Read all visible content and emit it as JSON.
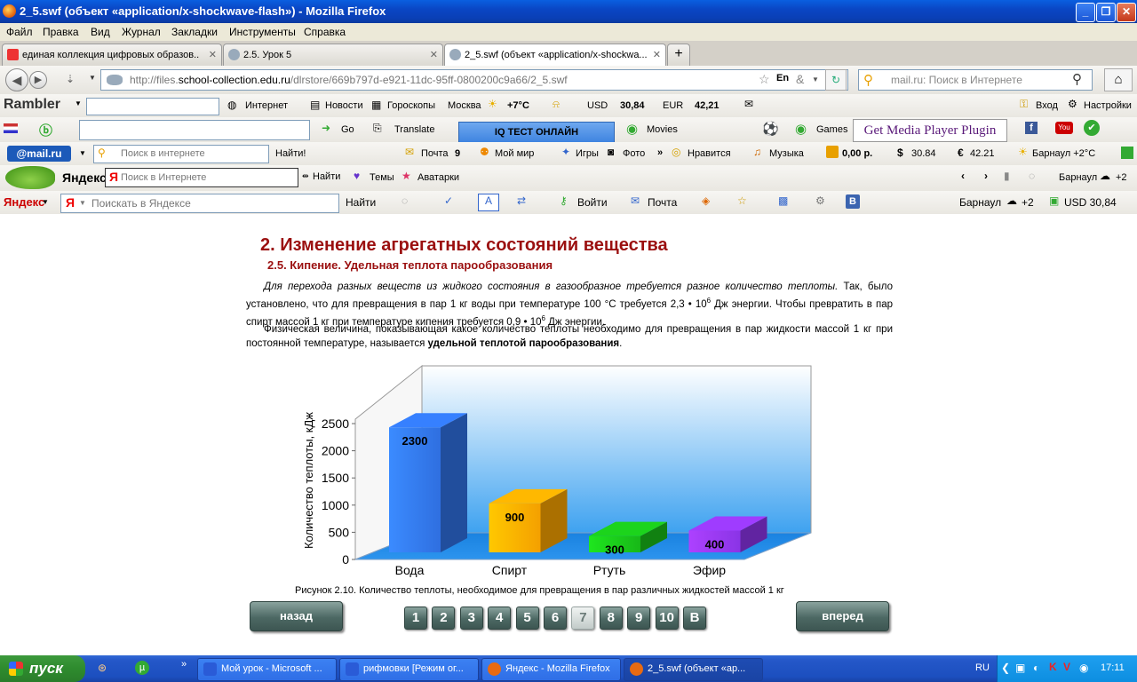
{
  "window": {
    "title": "2_5.swf (объект «application/x-shockwave-flash») - Mozilla Firefox",
    "min": "_",
    "max": "❐",
    "close": "✕"
  },
  "menu": [
    "Файл",
    "Правка",
    "Вид",
    "Журнал",
    "Закладки",
    "Инструменты",
    "Справка"
  ],
  "tabs": [
    {
      "label": "единая коллекция цифровых образов...",
      "close": "✕"
    },
    {
      "label": "2.5. Урок 5",
      "close": "✕"
    },
    {
      "label": "2_5.swf (объект «application/x-shockwa...",
      "close": "✕"
    }
  ],
  "new_tab": "+",
  "nav": {
    "url_prefix": "http://files.",
    "url_domain": "school-collection.edu.ru",
    "url_path": "/dlrstore/669b797d-e921-11dc-95ff-0800200c9a66/2_5.swf",
    "search_placeholder": "mail.ru: Поиск в Интернете",
    "lang": "En"
  },
  "rambler": {
    "logo": "Rambler",
    "internet": "Интернет",
    "news": "Новости",
    "horoscope": "Гороскопы",
    "city": "Москва",
    "temp": "+7°C",
    "usd_label": "USD",
    "usd": "30,84",
    "eur_label": "EUR",
    "eur": "42,21",
    "login": "Вход",
    "settings": "Настройки"
  },
  "toolbar2": {
    "go": "Go",
    "translate": "Translate",
    "iq": "IQ ТЕСТ ОНЛАЙН",
    "movies": "Movies",
    "games": "Games",
    "plugin": "Get Media Player Plugin"
  },
  "mailru": {
    "logo": "@mail.ru",
    "placeholder": "Поиск в интернете",
    "find": "Найти!",
    "mail": "Почта",
    "mail_count": "9",
    "myworld": "Мой мир",
    "games": "Игры",
    "photo": "Фото",
    "likes": "Нравится",
    "music": "Музыка",
    "money": "0,00 р.",
    "usd": "30.84",
    "eur": "42.21",
    "weather": "Барнаул +2°C"
  },
  "yandex_bar1": {
    "logo": "Яндекс",
    "placeholder": "Поиск в Интернете",
    "find": "Найти",
    "themes": "Темы",
    "avatars": "Аватарки",
    "city": "Барнаул",
    "temp": "+2"
  },
  "yandex_bar2": {
    "logo": "Яндекс",
    "placeholder": "Поискать в Яндексе",
    "find": "Найти",
    "login": "Войти",
    "mail": "Почта",
    "city": "Барнаул",
    "temp": "+2",
    "usd": "USD 30,84"
  },
  "page": {
    "title": "2. Изменение агрегатных состояний вещества",
    "subtitle": "2.5. Кипение. Удельная теплота парообразования",
    "p1_italic": "Для перехода разных веществ из жидкого состояния в газообразное требуется разное количество теплоты.",
    "p1_rest_a": " Так, было установлено, что для превращения в пар 1 кг воды при температуре 100 °С требуется 2,3 • 10",
    "p1_exp": "6",
    "p1_rest_b": " Дж энергии. Чтобы превратить в пар спирт массой 1 кг при температуре кипения требуется 0,9 • 10",
    "p1_exp2": "6",
    "p1_rest_c": " Дж энергии.",
    "p2_a": "Физическая величина, показывающая какое количество теплоты необходимо для превращения в пар жидкости массой 1 кг при постоянной температуре, называется ",
    "p2_bold": "удельной теплотой парообразования",
    "p2_end": ".",
    "caption": "Рисунок 2.10. Количество теплоты, необходимое для превращения в пар различных жидкостей массой 1 кг",
    "back": "назад",
    "forward": "вперед",
    "pages": [
      "1",
      "2",
      "3",
      "4",
      "5",
      "6",
      "7",
      "8",
      "9",
      "10",
      "В"
    ],
    "current_page": "7"
  },
  "chart_data": {
    "type": "bar",
    "categories": [
      "Вода",
      "Спирт",
      "Ртуть",
      "Эфир"
    ],
    "values": [
      2300,
      900,
      300,
      400
    ],
    "value_labels": [
      "2300",
      "900",
      "300",
      "400"
    ],
    "colors": [
      "#2f6fe0",
      "#f4a000",
      "#18b818",
      "#8a34e6"
    ],
    "ylabel": "Количество теплоты, кДж",
    "yticks": [
      "0",
      "500",
      "1000",
      "1500",
      "2000",
      "2500"
    ],
    "ylim": [
      0,
      2700
    ]
  },
  "taskbar": {
    "start": "пуск",
    "tasks": [
      "Мой урок - Microsoft ...",
      "рифмовки [Режим ог...",
      "Яндекс - Mozilla Firefox",
      "2_5.swf (объект «ap..."
    ],
    "lang": "RU",
    "time": "17:11"
  }
}
